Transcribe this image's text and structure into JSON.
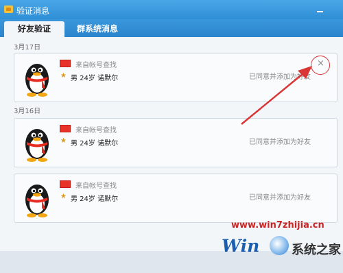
{
  "window": {
    "title": "验证消息"
  },
  "tabs": [
    {
      "label": "好友验证",
      "active": true
    },
    {
      "label": "群系统消息",
      "active": false
    }
  ],
  "groups": [
    {
      "date": "3月17日",
      "requests": [
        {
          "source": "来自帐号查找",
          "profile": "男 24岁 诺默尔",
          "status": "已同意并添加为好友"
        }
      ]
    },
    {
      "date": "3月16日",
      "requests": [
        {
          "source": "来自帐号查找",
          "profile": "男 24岁 诺默尔",
          "status": "已同意并添加为好友"
        },
        {
          "source": "来自帐号查找",
          "profile": "男 24岁 诺默尔",
          "status": "已同意并添加为好友"
        }
      ]
    }
  ],
  "close_label": "×",
  "annotation": {
    "color": "#d93535"
  },
  "watermark": {
    "url": "www.win7zhijia.cn",
    "logo_text": "Win",
    "site_name": "系统之家"
  },
  "icons": {
    "app": "qq-icon",
    "minimize": "minimize-icon",
    "avatar": "penguin-avatar-icon",
    "flag": "red-flag-icon",
    "level": "star-icon",
    "close": "close-icon"
  },
  "colors": {
    "titlebar": "#2f8fd6",
    "flag": "#e8332b",
    "watermark_red": "#c92525"
  }
}
